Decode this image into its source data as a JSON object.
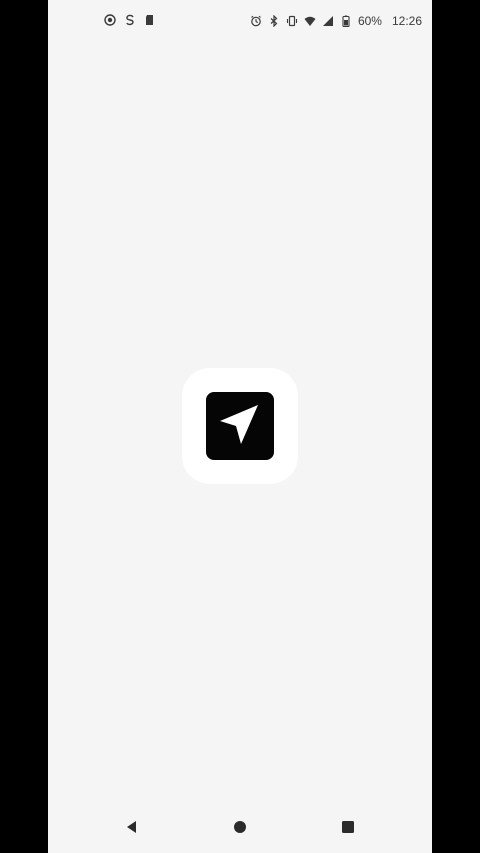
{
  "status_bar": {
    "left_icons": [
      "screen-record-icon",
      "sync-icon",
      "sd-card-icon"
    ],
    "right_icons": [
      "alarm-icon",
      "bluetooth-icon",
      "vibrate-icon",
      "wifi-icon",
      "signal-icon",
      "battery-icon"
    ],
    "battery": "60%",
    "time": "12:26"
  },
  "splash": {
    "icon": "navigation-arrow-icon",
    "background_color": "#f6f5f6",
    "icon_bg_color": "#050505"
  },
  "nav_bar": {
    "buttons": [
      "back-icon",
      "home-icon",
      "recents-icon"
    ]
  }
}
